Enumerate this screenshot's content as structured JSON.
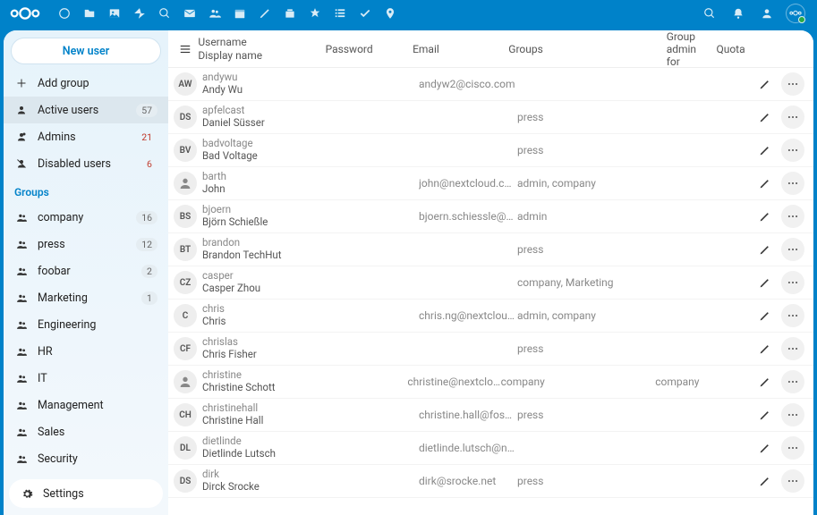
{
  "sidebar": {
    "newUser": "New user",
    "addGroup": "Add group",
    "activeUsers": {
      "label": "Active users",
      "count": "57"
    },
    "admins": {
      "label": "Admins",
      "count": "21"
    },
    "disabled": {
      "label": "Disabled users",
      "count": "6"
    },
    "groupsHeader": "Groups",
    "groups": [
      {
        "label": "company",
        "count": "16"
      },
      {
        "label": "press",
        "count": "12"
      },
      {
        "label": "foobar",
        "count": "2"
      },
      {
        "label": "Marketing",
        "count": "1"
      },
      {
        "label": "Engineering",
        "count": ""
      },
      {
        "label": "HR",
        "count": ""
      },
      {
        "label": "IT",
        "count": ""
      },
      {
        "label": "Management",
        "count": ""
      },
      {
        "label": "Sales",
        "count": ""
      },
      {
        "label": "Security",
        "count": ""
      }
    ],
    "settings": "Settings"
  },
  "table": {
    "headers": {
      "username": "Username",
      "displayname": "Display name",
      "password": "Password",
      "email": "Email",
      "groups": "Groups",
      "groupadmin": "Group admin for",
      "quota": "Quota"
    },
    "rows": [
      {
        "av": "AW",
        "avc": "av-aw",
        "u": "andywu",
        "d": "Andy Wu",
        "email": "andyw2@cisco.com",
        "groups": "",
        "gadmin": ""
      },
      {
        "av": "DS",
        "avc": "av-ds",
        "u": "apfelcast",
        "d": "Daniel Süsser",
        "email": "",
        "groups": "press",
        "gadmin": ""
      },
      {
        "av": "BV",
        "avc": "av-bv",
        "u": "badvoltage",
        "d": "Bad Voltage",
        "email": "",
        "groups": "press",
        "gadmin": ""
      },
      {
        "av": "",
        "avc": "av-img",
        "u": "barth",
        "d": "John",
        "email": "john@nextcloud.com",
        "groups": "admin, company",
        "gadmin": ""
      },
      {
        "av": "BS",
        "avc": "av-bs",
        "u": "bjoern",
        "d": "Björn Schießle",
        "email": "bjoern.schiessle@next…",
        "groups": "admin",
        "gadmin": ""
      },
      {
        "av": "BT",
        "avc": "av-bt",
        "u": "brandon",
        "d": "Brandon TechHut",
        "email": "",
        "groups": "press",
        "gadmin": ""
      },
      {
        "av": "CZ",
        "avc": "av-cz",
        "u": "casper",
        "d": "Casper Zhou",
        "email": "",
        "groups": "company, Marketing",
        "gadmin": ""
      },
      {
        "av": "C",
        "avc": "av-c",
        "u": "chris",
        "d": "Chris",
        "email": "chris.ng@nextcloud.c…",
        "groups": "admin, company",
        "gadmin": ""
      },
      {
        "av": "CF",
        "avc": "av-cf",
        "u": "chrislas",
        "d": "Chris Fisher",
        "email": "",
        "groups": "press",
        "gadmin": ""
      },
      {
        "av": "",
        "avc": "av-img",
        "u": "christine",
        "d": "Christine Schott",
        "email": "christine@nextcloud.c…",
        "groups": "company",
        "gadmin": "company"
      },
      {
        "av": "CH",
        "avc": "av-ch",
        "u": "christinehall",
        "d": "Christine Hall",
        "email": "christine.hall@fossforc…",
        "groups": "press",
        "gadmin": ""
      },
      {
        "av": "DL",
        "avc": "av-dl",
        "u": "dietlinde",
        "d": "Dietlinde Lutsch",
        "email": "dietlinde.lutsch@next…",
        "groups": "",
        "gadmin": ""
      },
      {
        "av": "DS",
        "avc": "av-ds2",
        "u": "dirk",
        "d": "Dirck Srocke",
        "email": "dirk@srocke.net",
        "groups": "press",
        "gadmin": ""
      }
    ]
  }
}
